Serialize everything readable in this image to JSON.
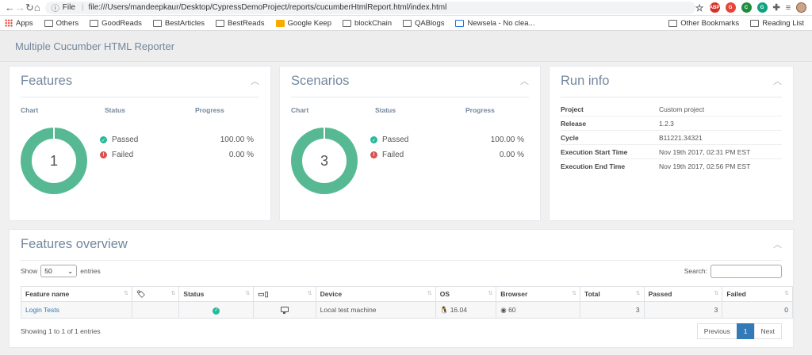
{
  "browser": {
    "file_label": "File",
    "url": "file:///Users/mandeepkaur/Desktop/CypressDemoProject/reports/cucumberHtmlReport.html/index.html",
    "extensions": [
      {
        "name": "abp",
        "label": "ABP"
      },
      {
        "name": "red",
        "label": "G"
      },
      {
        "name": "green",
        "label": "C"
      },
      {
        "name": "teal",
        "label": "G"
      }
    ]
  },
  "bookmarks": {
    "items": [
      {
        "label": "Apps",
        "icon": "apps-grid-icon"
      },
      {
        "label": "Others",
        "icon": "folder-icon"
      },
      {
        "label": "GoodReads",
        "icon": "folder-icon"
      },
      {
        "label": "BestArticles",
        "icon": "folder-icon"
      },
      {
        "label": "BestReads",
        "icon": "folder-icon"
      },
      {
        "label": "Google Keep",
        "icon": "keep-icon"
      },
      {
        "label": "blockChain",
        "icon": "folder-icon"
      },
      {
        "label": "QABlogs",
        "icon": "folder-icon"
      },
      {
        "label": "Newsela - No clea...",
        "icon": "newsela-icon"
      }
    ],
    "other_bookmarks": "Other Bookmarks",
    "reading_list": "Reading List"
  },
  "app": {
    "title": "Multiple Cucumber HTML Reporter"
  },
  "features": {
    "title": "Features",
    "headers": {
      "chart": "Chart",
      "status": "Status",
      "progress": "Progress"
    },
    "count": "1",
    "passed_fraction": 1.0,
    "rows": [
      {
        "label": "Passed",
        "value": "100.00 %",
        "status": "passed"
      },
      {
        "label": "Failed",
        "value": "0.00 %",
        "status": "failed"
      }
    ]
  },
  "scenarios": {
    "title": "Scenarios",
    "headers": {
      "chart": "Chart",
      "status": "Status",
      "progress": "Progress"
    },
    "count": "3",
    "passed_fraction": 1.0,
    "rows": [
      {
        "label": "Passed",
        "value": "100.00 %",
        "status": "passed"
      },
      {
        "label": "Failed",
        "value": "0.00 %",
        "status": "failed"
      }
    ]
  },
  "run_info": {
    "title": "Run info",
    "rows": [
      {
        "key": "Project",
        "value": "Custom project"
      },
      {
        "key": "Release",
        "value": "1.2.3"
      },
      {
        "key": "Cycle",
        "value": "B11221.34321"
      },
      {
        "key": "Execution Start Time",
        "value": "Nov 19th 2017, 02:31 PM EST"
      },
      {
        "key": "Execution End Time",
        "value": "Nov 19th 2017, 02:56 PM EST"
      }
    ]
  },
  "overview": {
    "title": "Features overview",
    "show_label": "Show",
    "entries_value": "50",
    "entries_label": "entries",
    "search_label": "Search:",
    "columns": [
      "Feature name",
      "",
      "Status",
      "",
      "Device",
      "OS",
      "Browser",
      "Total",
      "Passed",
      "Failed"
    ],
    "row": {
      "feature_name": "Login Tests",
      "device": "Local test machine",
      "os": "16.04",
      "browser": "60",
      "total": "3",
      "passed": "3",
      "failed": "0"
    },
    "showing": "Showing 1 to 1 of 1 entries",
    "pager": {
      "previous": "Previous",
      "page": "1",
      "next": "Next"
    }
  }
}
